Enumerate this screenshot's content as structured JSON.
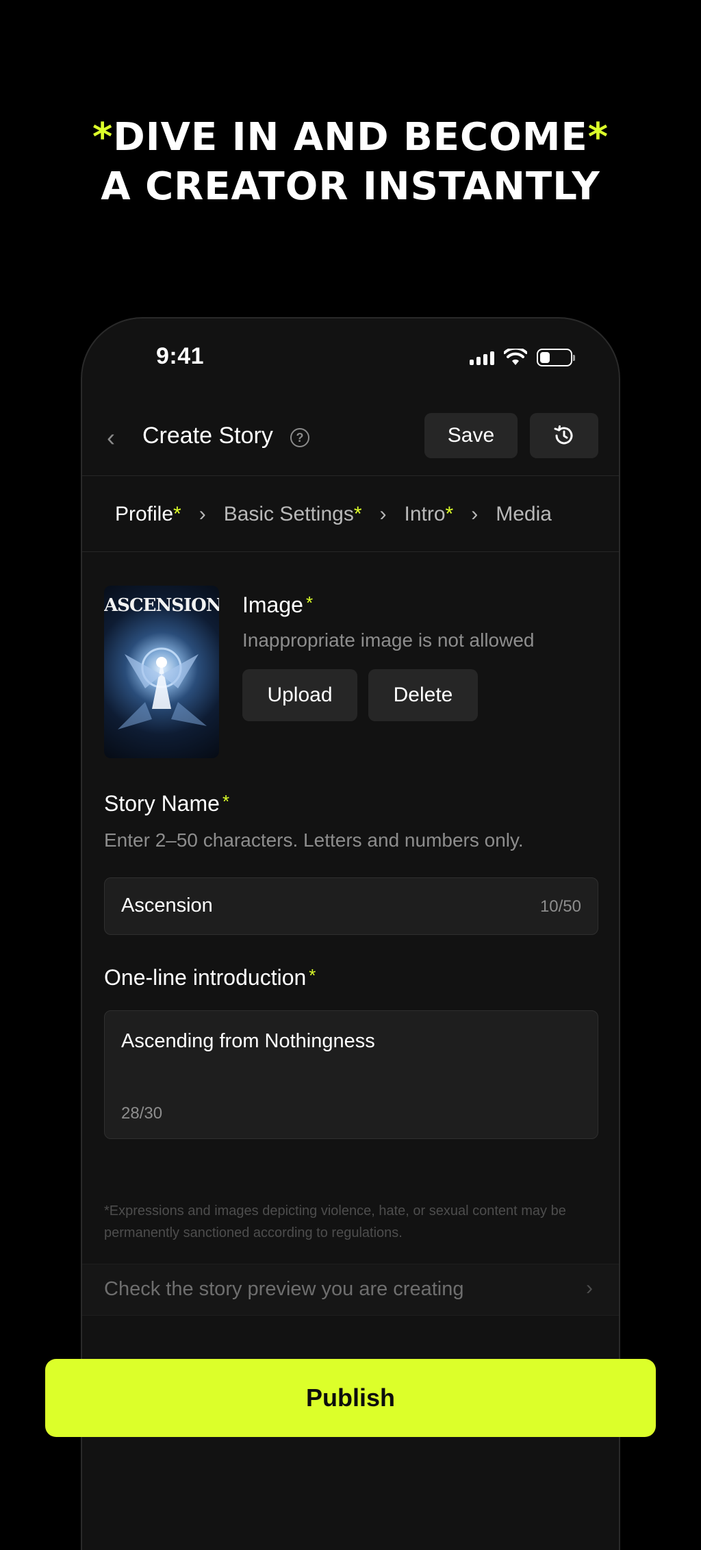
{
  "headline": {
    "star": "*",
    "line1": "DIVE IN AND BECOME",
    "line2": "A CREATOR INSTANTLY",
    "accent_color": "#dcff2a"
  },
  "status_bar": {
    "time": "9:41",
    "icons": [
      "signal-icon",
      "wifi-icon",
      "battery-icon"
    ]
  },
  "header": {
    "back_icon": "chevron-left-icon",
    "title": "Create Story",
    "help_icon": "question-circle-icon",
    "save_label": "Save",
    "history_icon": "history-icon"
  },
  "steps": [
    {
      "label": "Profile",
      "required": "*",
      "active": true
    },
    {
      "label": "Basic Settings",
      "required": "*",
      "active": false
    },
    {
      "label": "Intro",
      "required": "*",
      "active": false
    },
    {
      "label": "Media",
      "required": "",
      "active": false
    }
  ],
  "image_section": {
    "cover_title": "ASCENSION",
    "label": "Image",
    "required": "*",
    "hint": "Inappropriate image is not allowed",
    "upload_label": "Upload",
    "delete_label": "Delete"
  },
  "story_name": {
    "label": "Story Name",
    "required": "*",
    "hint": "Enter 2–50 characters. Letters and numbers only.",
    "value": "Ascension",
    "counter": "10/50"
  },
  "intro": {
    "label": "One-line introduction",
    "required": "*",
    "value": "Ascending from Nothingness",
    "counter": "28/30"
  },
  "disclaimer": "*Expressions and images depicting violence, hate, or sexual content may be permanently sanctioned according to regulations.",
  "preview": {
    "label": "Check the story preview you are creating",
    "icon": "chevron-right-icon"
  },
  "publish_label": "Publish"
}
